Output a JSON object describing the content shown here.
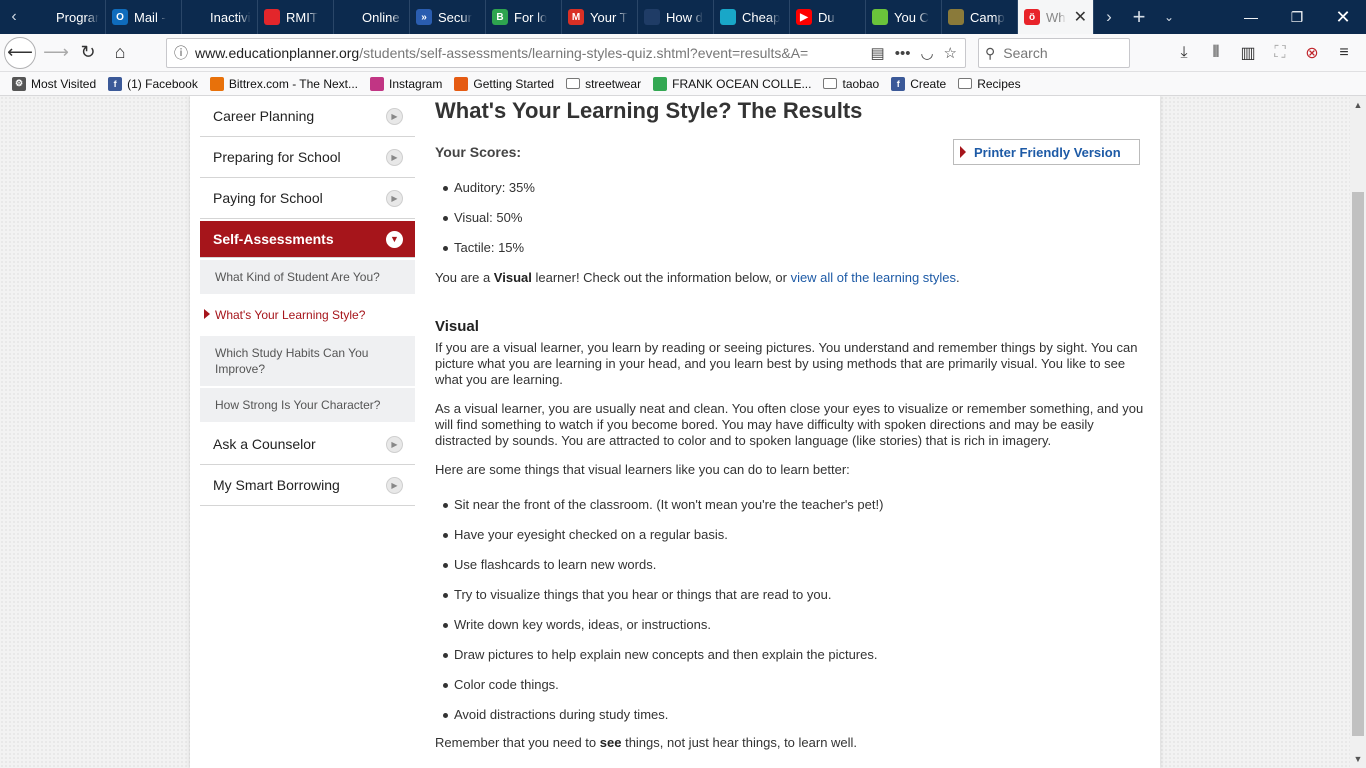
{
  "tabs": [
    {
      "label": "Programs",
      "icon_color": "#0c2a4e",
      "icon": ""
    },
    {
      "label": "Mail -",
      "icon_color": "#0f6cbd",
      "icon": "O"
    },
    {
      "label": "Inactivity T",
      "icon_color": "#0c2a4e",
      "icon": ""
    },
    {
      "label": "RMIT",
      "icon_color": "#e3262b",
      "icon": ""
    },
    {
      "label": "Online Ap",
      "icon_color": "#0c2a4e",
      "icon": ""
    },
    {
      "label": "Secur",
      "icon_color": "#2a5db0",
      "icon": "»"
    },
    {
      "label": "For lo",
      "icon_color": "#2ea44f",
      "icon": "B"
    },
    {
      "label": "Your T",
      "icon_color": "#d93025",
      "icon": "M"
    },
    {
      "label": "How d",
      "icon_color": "#1f3c66",
      "icon": ""
    },
    {
      "label": "Cheap",
      "icon_color": "#19a7c8",
      "icon": ""
    },
    {
      "label": "Du",
      "icon_color": "#ff0000",
      "icon": "▶"
    },
    {
      "label": "You C",
      "icon_color": "#6ac33b",
      "icon": ""
    },
    {
      "label": "Camp",
      "icon_color": "#8a7a3a",
      "icon": ""
    },
    {
      "label": "Wh",
      "icon_color": "#e8232a",
      "icon": "ö"
    }
  ],
  "url": {
    "host": "www.educationplanner.org",
    "rest": "/students/self-assessments/learning-styles-quiz.shtml?event=results&A="
  },
  "search_placeholder": "Search",
  "bookmarks": [
    {
      "label": "Most Visited",
      "icon": "⚙",
      "icon_color": "#555"
    },
    {
      "label": "(1) Facebook",
      "icon": "f",
      "icon_color": "#3b5998"
    },
    {
      "label": "Bittrex.com - The Next...",
      "icon": "",
      "icon_color": "#e8710a"
    },
    {
      "label": "Instagram",
      "icon": "",
      "icon_color": "#c13584"
    },
    {
      "label": "Getting Started",
      "icon": "",
      "icon_color": "#e55b13"
    },
    {
      "label": "streetwear",
      "icon": "",
      "icon_color": "folder"
    },
    {
      "label": "FRANK OCEAN COLLE...",
      "icon": "",
      "icon_color": "#34a853"
    },
    {
      "label": "taobao",
      "icon": "",
      "icon_color": "folder"
    },
    {
      "label": "Create",
      "icon": "f",
      "icon_color": "#3b5998"
    },
    {
      "label": "Recipes",
      "icon": "",
      "icon_color": "folder"
    }
  ],
  "sidebar": {
    "items_top": [
      "Career Planning",
      "Preparing for School",
      "Paying for School"
    ],
    "active": "Self-Assessments",
    "subitems": [
      "What Kind of Student Are You?",
      "What's Your Learning Style?",
      "Which Study Habits Can You Improve?",
      "How Strong Is Your Character?"
    ],
    "items_bottom": [
      "Ask a Counselor",
      "My Smart Borrowing"
    ]
  },
  "content": {
    "title": "What's Your Learning Style? The Results",
    "scores_label": "Your Scores:",
    "printer_label": "Printer Friendly Version",
    "scores": [
      "Auditory: 35%",
      "Visual: 50%",
      "Tactile: 15%"
    ],
    "result_pre": "You are a ",
    "result_bold": "Visual",
    "result_mid": " learner! Check out the information below, or ",
    "result_link": "view all of the learning styles",
    "result_post": ".",
    "section_title": "Visual",
    "para1": "If you are a visual learner, you learn by reading or seeing pictures. You understand and remember things by sight. You can picture what you are learning in your head, and you learn best by using methods that are primarily visual. You like to see what you are learning.",
    "para2": "As a visual learner, you are usually neat and clean. You often close your eyes to visualize or remember something, and you will find something to watch if you become bored. You may have difficulty with spoken directions and may be easily distracted by sounds. You are attracted to color and to spoken language (like stories) that is rich in imagery.",
    "para3": "Here are some things that visual learners like you can do to learn better:",
    "tips": [
      "Sit near the front of the classroom. (It won't mean you're the teacher's pet!)",
      "Have your eyesight checked on a regular basis.",
      "Use flashcards to learn new words.",
      "Try to visualize things that you hear or things that are read to you.",
      "Write down key words, ideas, or instructions.",
      "Draw pictures to help explain new concepts and then explain the pictures.",
      "Color code things.",
      "Avoid distractions during study times."
    ],
    "closing_pre": "Remember that you need to ",
    "closing_bold": "see",
    "closing_post": " things, not just hear things, to learn well."
  }
}
